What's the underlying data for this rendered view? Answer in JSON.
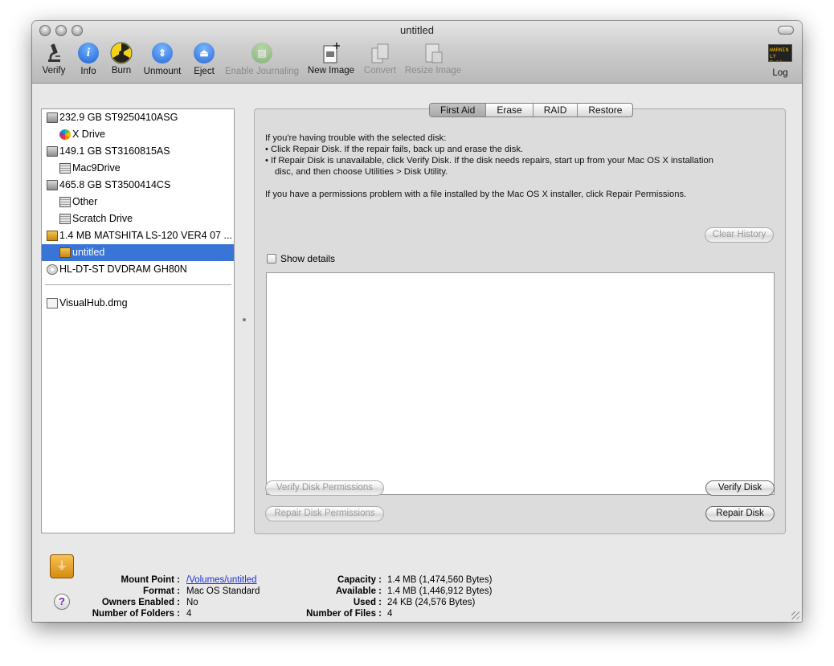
{
  "window": {
    "title": "untitled"
  },
  "toolbar": {
    "verify": "Verify",
    "info": "Info",
    "burn": "Burn",
    "unmount": "Unmount",
    "eject": "Eject",
    "enable_journaling": "Enable Journaling",
    "new_image": "New Image",
    "convert": "Convert",
    "resize_image": "Resize Image",
    "log": "Log",
    "log_icon_text": "WARNIN LY 7:36"
  },
  "sidebar": {
    "items": [
      {
        "label": "232.9 GB ST9250410ASG",
        "icon": "hard-disk-icon"
      },
      {
        "label": "X Drive",
        "icon": "apple-volume-icon"
      },
      {
        "label": "149.1 GB ST3160815AS",
        "icon": "hard-disk-icon"
      },
      {
        "label": "Mac9Drive",
        "icon": "volume-icon"
      },
      {
        "label": "465.8 GB ST3500414CS",
        "icon": "hard-disk-icon"
      },
      {
        "label": "Other",
        "icon": "volume-icon"
      },
      {
        "label": "Scratch Drive",
        "icon": "volume-icon"
      },
      {
        "label": "1.4 MB MATSHITA LS-120 VER4 07 ...",
        "icon": "zip-disk-icon"
      },
      {
        "label": "untitled",
        "icon": "zip-volume-icon",
        "selected": true
      },
      {
        "label": "HL-DT-ST DVDRAM GH80N",
        "icon": "optical-drive-icon"
      }
    ],
    "images": [
      {
        "label": "VisualHub.dmg",
        "icon": "disk-image-icon"
      }
    ]
  },
  "tabs": [
    "First Aid",
    "Erase",
    "RAID",
    "Restore"
  ],
  "active_tab": "First Aid",
  "first_aid": {
    "line1": "If you're having trouble with the selected disk:",
    "line2": "• Click Repair Disk. If the repair fails, back up and erase the disk.",
    "line3": "• If Repair Disk is unavailable, click Verify Disk. If the disk needs repairs, start up from your Mac OS X installation",
    "line4": "disc, and then choose Utilities > Disk Utility.",
    "line5": "If you have a permissions problem with a file installed by the Mac OS X installer, click Repair Permissions.",
    "show_details": "Show details",
    "clear_history": "Clear History",
    "verify_permissions": "Verify Disk Permissions",
    "repair_permissions": "Repair Disk Permissions",
    "verify_disk": "Verify Disk",
    "repair_disk": "Repair Disk"
  },
  "info": {
    "mount_point_label": "Mount Point :",
    "mount_point": "/Volumes/untitled",
    "format_label": "Format :",
    "format": "Mac OS Standard",
    "owners_label": "Owners Enabled :",
    "owners": "No",
    "folders_label": "Number of Folders :",
    "folders": "4",
    "capacity_label": "Capacity :",
    "capacity": "1.4 MB (1,474,560 Bytes)",
    "available_label": "Available :",
    "available": "1.4 MB (1,446,912 Bytes)",
    "used_label": "Used :",
    "used": "24 KB (24,576 Bytes)",
    "files_label": "Number of Files :",
    "files": "4"
  },
  "colors": {
    "selection": "#3875d7",
    "link": "#1a2ed8"
  }
}
